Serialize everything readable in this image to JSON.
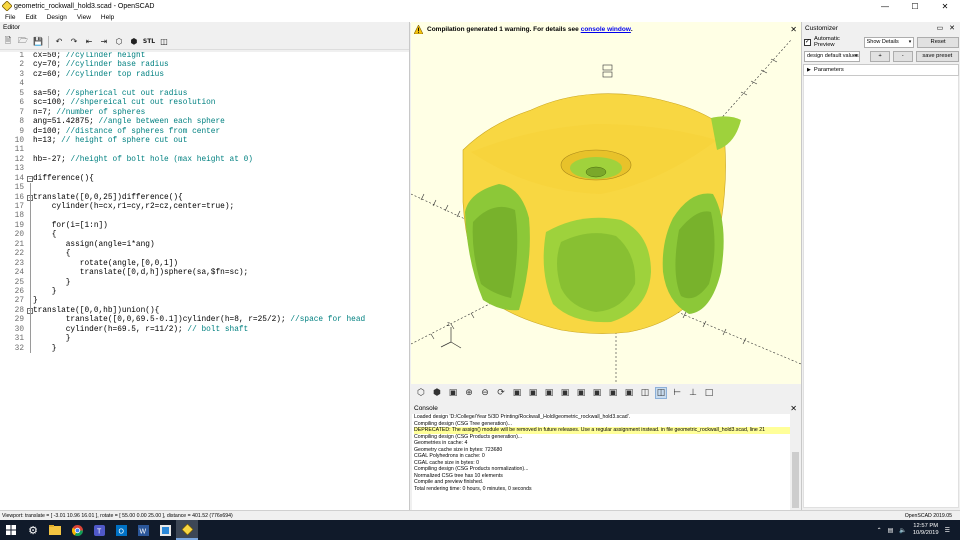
{
  "window": {
    "title": "geometric_rockwall_hold3.scad - OpenSCAD",
    "minimize_icon": "minimize-icon",
    "maximize_icon": "maximize-icon",
    "close_icon": "close-icon"
  },
  "menu": [
    "File",
    "Edit",
    "Design",
    "View",
    "Help"
  ],
  "editor": {
    "title": "Editor",
    "toolbar": [
      "new-file-icon",
      "open-file-icon",
      "save-icon",
      "undo-icon",
      "redo-icon",
      "unindent-icon",
      "indent-icon",
      "preview-icon",
      "render-icon",
      "export-stl-icon",
      "send-to-print-icon"
    ],
    "lines": [
      {
        "n": "1",
        "code": "cx=50;",
        "comment": " //cylinder height"
      },
      {
        "n": "2",
        "code": "cy=70;",
        "comment": " //cylinder base radius"
      },
      {
        "n": "3",
        "code": "cz=60;",
        "comment": " //cylinder top radius"
      },
      {
        "n": "4",
        "code": "",
        "comment": ""
      },
      {
        "n": "5",
        "code": "sa=50;",
        "comment": " //spherical cut out radius"
      },
      {
        "n": "6",
        "code": "sc=100;",
        "comment": " //shpereical cut out resolution"
      },
      {
        "n": "7",
        "code": "n=7;",
        "comment": " //number of spheres"
      },
      {
        "n": "8",
        "code": "ang=51.42875;",
        "comment": " //angle between each sphere"
      },
      {
        "n": "9",
        "code": "d=100;",
        "comment": " //distance of spheres from center"
      },
      {
        "n": "10",
        "code": "h=13;",
        "comment": " // height of sphere cut out"
      },
      {
        "n": "11",
        "code": "",
        "comment": ""
      },
      {
        "n": "12",
        "code": "hb=-27;",
        "comment": " //height of bolt hole (max height at 0)"
      },
      {
        "n": "13",
        "code": "",
        "comment": ""
      },
      {
        "n": "14",
        "code": "difference(){",
        "comment": ""
      },
      {
        "n": "15",
        "code": "",
        "comment": ""
      },
      {
        "n": "16",
        "code": "translate([0,0,25])difference(){",
        "comment": ""
      },
      {
        "n": "17",
        "code": "    cylinder(h=cx,r1=cy,r2=cz,center=true);",
        "comment": ""
      },
      {
        "n": "18",
        "code": "",
        "comment": ""
      },
      {
        "n": "19",
        "code": "    for(i=[1:n])",
        "comment": ""
      },
      {
        "n": "20",
        "code": "    {",
        "comment": ""
      },
      {
        "n": "21",
        "code": "       assign(angle=i*ang)",
        "comment": ""
      },
      {
        "n": "22",
        "code": "       {",
        "comment": ""
      },
      {
        "n": "23",
        "code": "          rotate(angle,[0,0,1])",
        "comment": ""
      },
      {
        "n": "24",
        "code": "          translate([0,d,h])sphere(sa,$fn=sc);",
        "comment": ""
      },
      {
        "n": "25",
        "code": "       }",
        "comment": ""
      },
      {
        "n": "26",
        "code": "    }",
        "comment": ""
      },
      {
        "n": "27",
        "code": "}",
        "comment": ""
      },
      {
        "n": "28",
        "code": "translate([0,0,hb])union(){",
        "comment": ""
      },
      {
        "n": "29",
        "code": "       translate([0,0,69.5-0.1])cylinder(h=8, r=25/2);",
        "comment": " //space for head"
      },
      {
        "n": "30",
        "code": "       cylinder(h=69.5, r=11/2);",
        "comment": " // bolt shaft"
      },
      {
        "n": "31",
        "code": "       }",
        "comment": ""
      },
      {
        "n": "32",
        "code": "    }",
        "comment": ""
      }
    ]
  },
  "viewer": {
    "warning_text": "Compilation generated 1 warning. For details see",
    "warning_link": "console window",
    "warning_suffix": ".",
    "toolbar": [
      "preview-icon",
      "render-icon",
      "zoom-all-icon",
      "zoom-in-icon",
      "zoom-out-icon",
      "reset-view-icon",
      "view-right-icon",
      "view-top-icon",
      "view-bottom-icon",
      "view-left-icon",
      "view-front-icon",
      "view-back-icon",
      "view-diagonal-icon",
      "view-center-icon",
      "perspective-icon",
      "orthogonal-icon",
      "show-axes-icon",
      "show-scale-icon",
      "show-edges-icon"
    ],
    "axis_label_z": "z",
    "model_color": "#f8d742",
    "cut_color": "#9ed23c"
  },
  "console": {
    "title": "Console",
    "lines": [
      {
        "text": "Loaded design 'D:/College/Year 5/3D Printing/Rockwall_Hold/geometric_rockwall_hold3.scad'.",
        "warn": false
      },
      {
        "text": "Compiling design (CSG Tree generation)...",
        "warn": false
      },
      {
        "text": "DEPRECATED: The assign() module will be removed in future releases. Use a regular assignment instead. in file geometric_rockwall_hold3.scad, line 21",
        "warn": true
      },
      {
        "text": "Compiling design (CSG Products generation)...",
        "warn": false
      },
      {
        "text": "Geometries in cache: 4",
        "warn": false
      },
      {
        "text": "Geometry cache size in bytes: 723680",
        "warn": false
      },
      {
        "text": "CGAL Polyhedrons in cache: 0",
        "warn": false
      },
      {
        "text": "CGAL cache size in bytes: 0",
        "warn": false
      },
      {
        "text": "Compiling design (CSG Products normalization)...",
        "warn": false
      },
      {
        "text": "Normalized CSG tree has 10 elements",
        "warn": false
      },
      {
        "text": "Compile and preview finished.",
        "warn": false
      },
      {
        "text": "Total rendering time: 0 hours, 0 minutes, 0 seconds",
        "warn": false
      }
    ]
  },
  "customizer": {
    "title": "Customizer",
    "auto_preview_label": "Automatic Preview",
    "auto_preview_checked": true,
    "details_select": "Show Details",
    "reset_label": "Reset",
    "preset_select": "design default values",
    "add_label": "+",
    "remove_label": "-",
    "save_preset_label": "save preset",
    "parameters_label": "Parameters"
  },
  "statusbar": {
    "viewport": "Viewport: translate = [ -3.01 10.96 16.01 ], rotate = [ 55.00 0.00 25.00 ], distance = 401.52 (776x694)",
    "version": "OpenSCAD 2019.05"
  },
  "taskbar": {
    "time": "12:57 PM",
    "date": "10/9/2019",
    "apps": [
      "windows-start-icon",
      "settings-icon",
      "file-explorer-icon",
      "chrome-icon",
      "teams-icon",
      "outlook-icon",
      "word-icon",
      "files-icon",
      "openscad-icon"
    ]
  }
}
